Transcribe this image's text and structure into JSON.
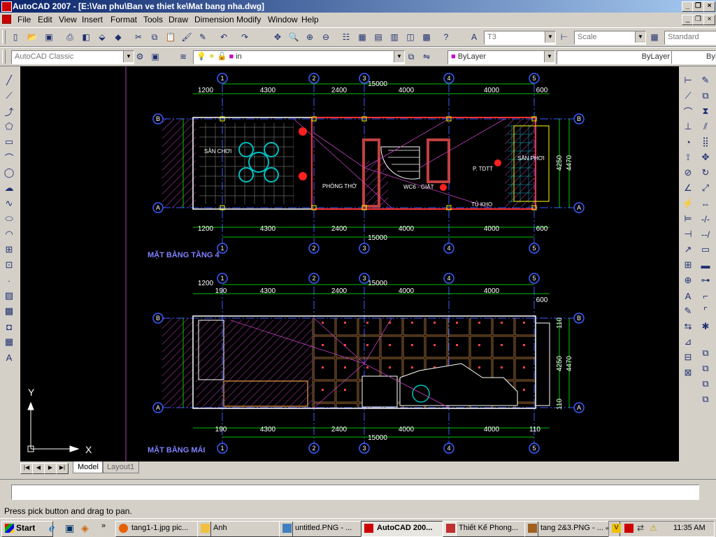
{
  "window": {
    "title": "AutoCAD 2007 - [E:\\Van phu\\Ban ve thiet ke\\Mat bang nha.dwg]"
  },
  "menu": [
    "File",
    "Edit",
    "View",
    "Insert",
    "Format",
    "Tools",
    "Draw",
    "Dimension",
    "Modify",
    "Window",
    "Help"
  ],
  "toolbar": {
    "text_style": "T3",
    "dim_style": "Scale",
    "table_style": "Standard",
    "workspace": "AutoCAD Classic",
    "layer": "in",
    "color": "ByLayer",
    "linetype": "ByLayer",
    "lineweight": "ByL"
  },
  "drawing": {
    "grid_labels": [
      "1",
      "2",
      "3",
      "4",
      "5"
    ],
    "row_labels": [
      "B",
      "A"
    ],
    "top_dims": [
      "1200",
      "4300",
      "2400",
      "4000",
      "4000",
      "600"
    ],
    "total_dim": "15000",
    "side_dims": [
      "4250",
      "4470"
    ],
    "roof_top_dims": [
      "1200",
      "190",
      "4300",
      "2400",
      "4000",
      "4000",
      "600"
    ],
    "roof_bottom_dims": [
      "190",
      "4300",
      "2400",
      "4000",
      "4000",
      "110"
    ],
    "roof_side_dims": [
      "110",
      "4250",
      "4470",
      "110"
    ],
    "rooms": [
      "SÂN CHƠI",
      "PHÒNG THỜ",
      "WC6 - GIẶT",
      "P. TDTT",
      "SÂN PHƠI",
      "TỦ KHO"
    ],
    "plan4_title": "MẶT BẰNG TẦNG 4",
    "roof_title": "MẶT BẰNG MÁI",
    "ucs_y": "Y",
    "ucs_x": "X"
  },
  "tabs": [
    "Model",
    "Layout1"
  ],
  "status_text": "Press pick button and drag to pan.",
  "taskbar": {
    "start": "Start",
    "tasks": [
      "tang1-1.jpg pic...",
      "Anh",
      "untitled.PNG - ...",
      "AutoCAD 200...",
      "Thiết Kế Phong...",
      "tang 2&3.PNG - ..."
    ],
    "clock": "11:35 AM"
  },
  "colors": {
    "canvas": "#000000",
    "dim_green": "#00ff00",
    "grid_blue": "#3a5cff",
    "wall_white": "#ffffff",
    "hatch_magenta": "#c040c0",
    "wall_red": "#ff3030",
    "yellow": "#ffff00",
    "cyan": "#00c0c0",
    "title_text": "#8080ff"
  }
}
